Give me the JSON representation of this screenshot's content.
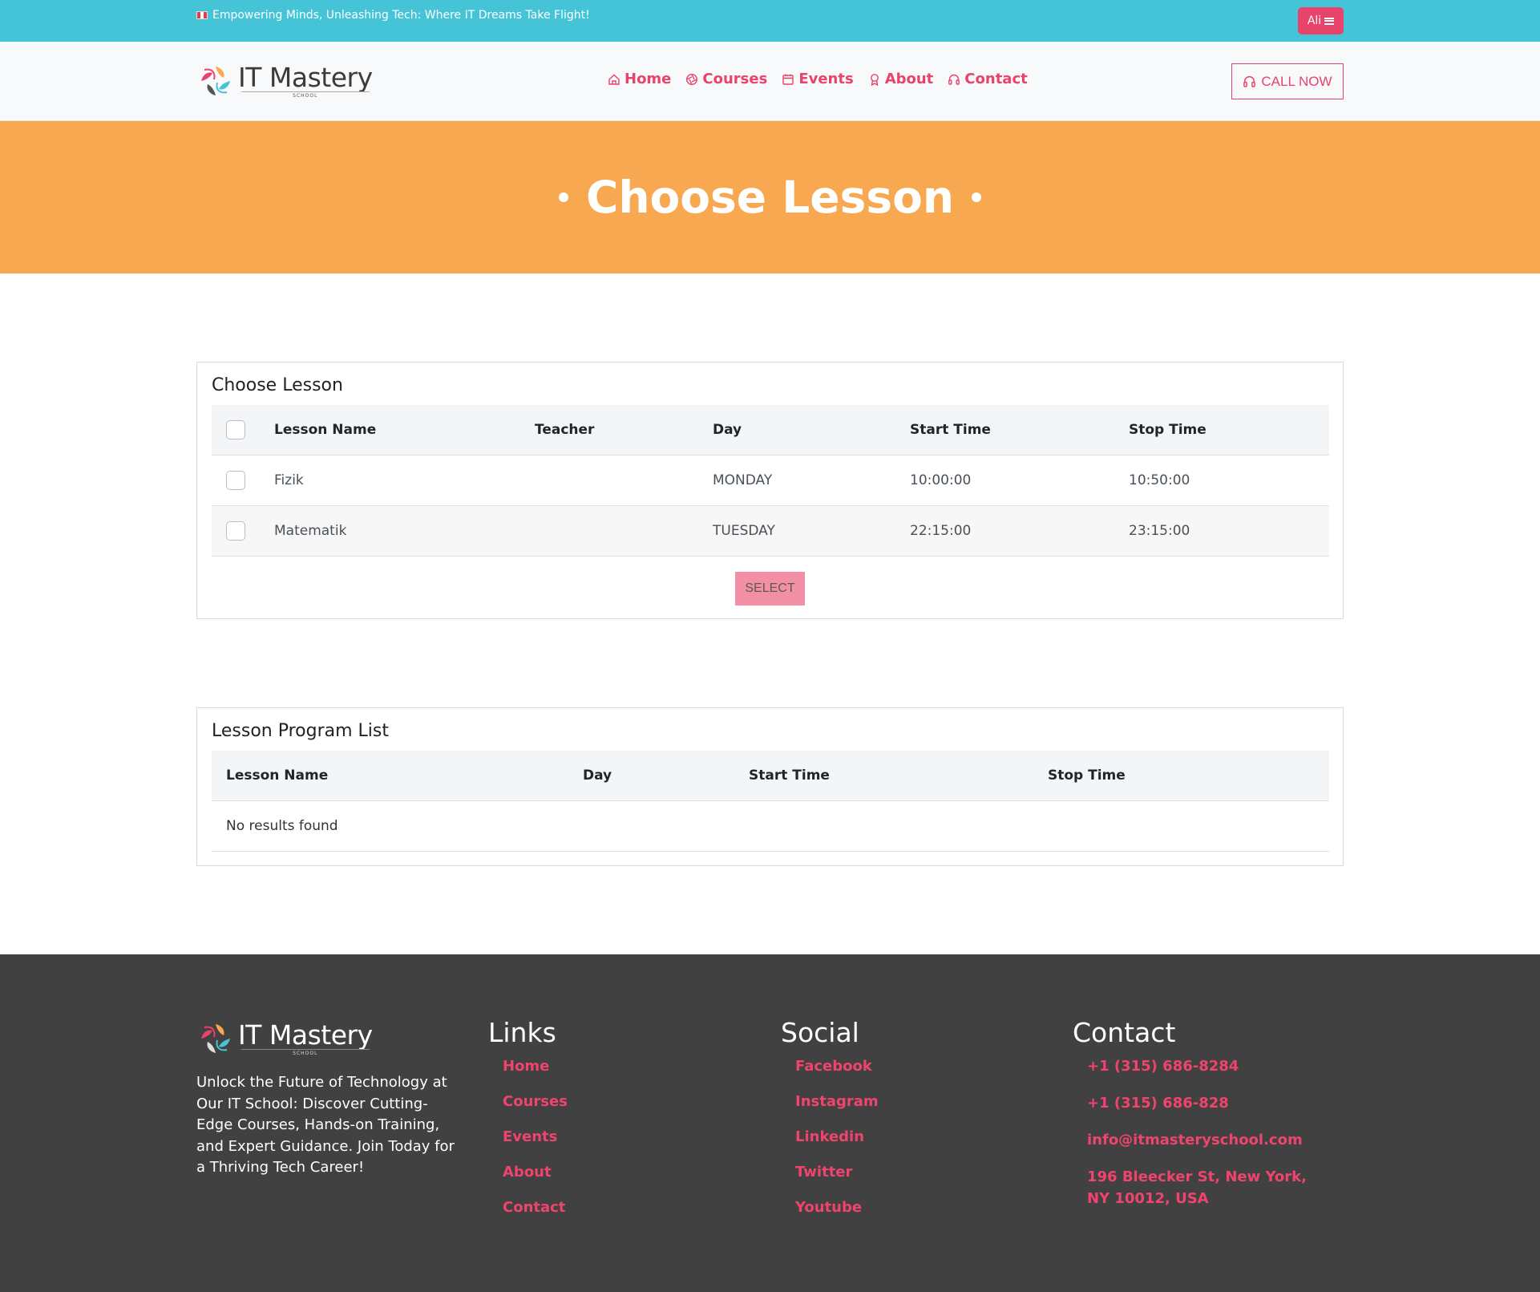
{
  "topbar": {
    "tagline": "Empowering Minds, Unleashing Tech: Where IT Dreams Take Flight!",
    "user_label": "Ali"
  },
  "brand": {
    "name": "IT Mastery",
    "sub": "SCHOOL"
  },
  "nav": {
    "items": [
      {
        "label": "Home",
        "icon": "home-icon"
      },
      {
        "label": "Courses",
        "icon": "aperture-icon"
      },
      {
        "label": "Events",
        "icon": "calendar-icon"
      },
      {
        "label": "About",
        "icon": "award-icon"
      },
      {
        "label": "Contact",
        "icon": "headset-icon"
      }
    ],
    "call_label": "CALL NOW"
  },
  "hero": {
    "title": "Choose Lesson"
  },
  "choose_lesson": {
    "title": "Choose Lesson",
    "columns": [
      "Lesson Name",
      "Teacher",
      "Day",
      "Start Time",
      "Stop Time"
    ],
    "rows": [
      {
        "lesson": "Fizik",
        "teacher": "",
        "day": "MONDAY",
        "start": "10:00:00",
        "stop": "10:50:00"
      },
      {
        "lesson": "Matematik",
        "teacher": "",
        "day": "TUESDAY",
        "start": "22:15:00",
        "stop": "23:15:00"
      }
    ],
    "select_label": "SELECT"
  },
  "program_list": {
    "title": "Lesson Program List",
    "columns": [
      "Lesson Name",
      "Day",
      "Start Time",
      "Stop Time"
    ],
    "empty_text": "No results found"
  },
  "footer": {
    "description": "Unlock the Future of Technology at Our IT School: Discover Cutting-Edge Courses, Hands-on Training, and Expert Guidance. Join Today for a Thriving Tech Career!",
    "links": {
      "title": "Links",
      "items": [
        "Home",
        "Courses",
        "Events",
        "About",
        "Contact"
      ]
    },
    "social": {
      "title": "Social",
      "items": [
        "Facebook",
        "Instagram",
        "Linkedin",
        "Twitter",
        "Youtube"
      ]
    },
    "contact": {
      "title": "Contact",
      "phone1": "+1 (315) 686-8284",
      "phone2": "+1 (315) 686-828",
      "email": "info@itmasteryschool.com",
      "address": "196 Bleecker St, New York, NY 10012, USA"
    }
  },
  "colors": {
    "topbar": "#45c4d8",
    "accent": "#e8436a",
    "hero": "#f9a852",
    "footer": "#414141"
  }
}
